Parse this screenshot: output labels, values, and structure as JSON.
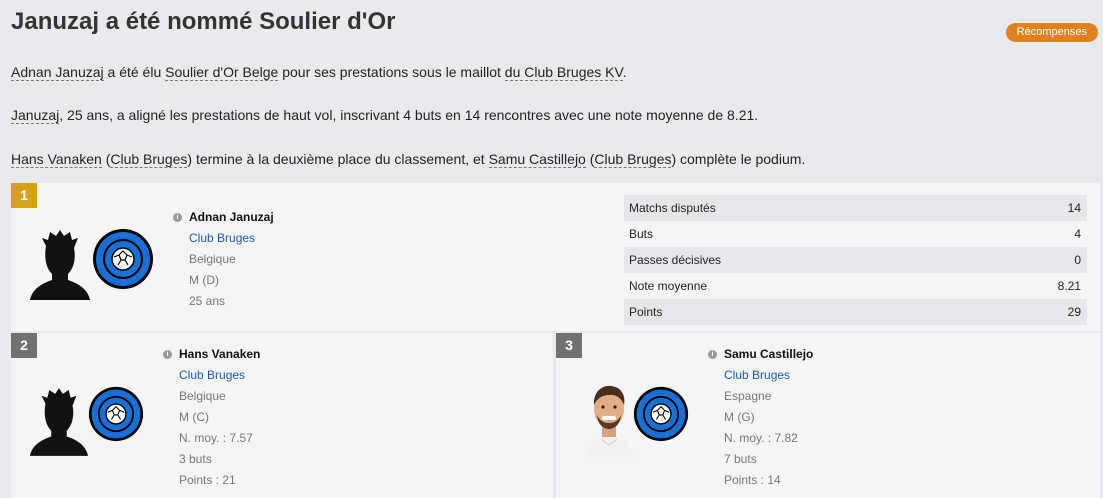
{
  "header": {
    "title": "Januzaj a été nommé Soulier d'Or",
    "rewards_button": "Récompenses"
  },
  "paragraphs": {
    "p1": {
      "player": "Adnan Januzaj",
      "t1": " a été élu ",
      "award": "Soulier d'Or Belge",
      "t2": " pour ses prestations sous le maillot ",
      "club": "du Club Bruges KV",
      "t3": "."
    },
    "p2": {
      "player": "Januzaj",
      "t1": ", 25 ans, a aligné les prestations de haut vol, inscrivant 4 buts en 14 rencontres avec une note moyenne de 8.21."
    },
    "p3": {
      "player1": "Hans Vanaken",
      "t1": " (",
      "club1": "Club Bruges",
      "t2": ") termine à la deuxième place du classement, et ",
      "player2": "Samu Castillejo",
      "t3": " (",
      "club2": "Club Bruges",
      "t4": ") complète le podium."
    }
  },
  "first": {
    "rank": "1",
    "name": "Adnan Januzaj",
    "club": "Club Bruges",
    "nation": "Belgique",
    "position": "M (D)",
    "age": "25 ans",
    "stats": [
      {
        "label": "Matchs disputés",
        "value": "14"
      },
      {
        "label": "Buts",
        "value": "4"
      },
      {
        "label": "Passes décisives",
        "value": "0"
      },
      {
        "label": "Note moyenne",
        "value": "8.21"
      },
      {
        "label": "Points",
        "value": "29"
      }
    ]
  },
  "second": {
    "rank": "2",
    "name": "Hans Vanaken",
    "club": "Club Bruges",
    "nation": "Belgique",
    "position": "M (C)",
    "rating": "N. moy. : 7.57",
    "goals": "3 buts",
    "points": "Points : 21"
  },
  "third": {
    "rank": "3",
    "name": "Samu Castillejo",
    "club": "Club Bruges",
    "nation": "Espagne",
    "position": "M (G)",
    "rating": "N. moy. : 7.82",
    "goals": "7 buts",
    "points": "Points : 14"
  },
  "icons": {
    "info": "info-icon",
    "club_badge": "club-bruges-badge",
    "silhouette": "player-silhouette"
  },
  "colors": {
    "accent_orange": "#e0811e",
    "gold": "#d4a118",
    "link_blue": "#1d5ab8",
    "badge_blue": "#1670d6"
  }
}
